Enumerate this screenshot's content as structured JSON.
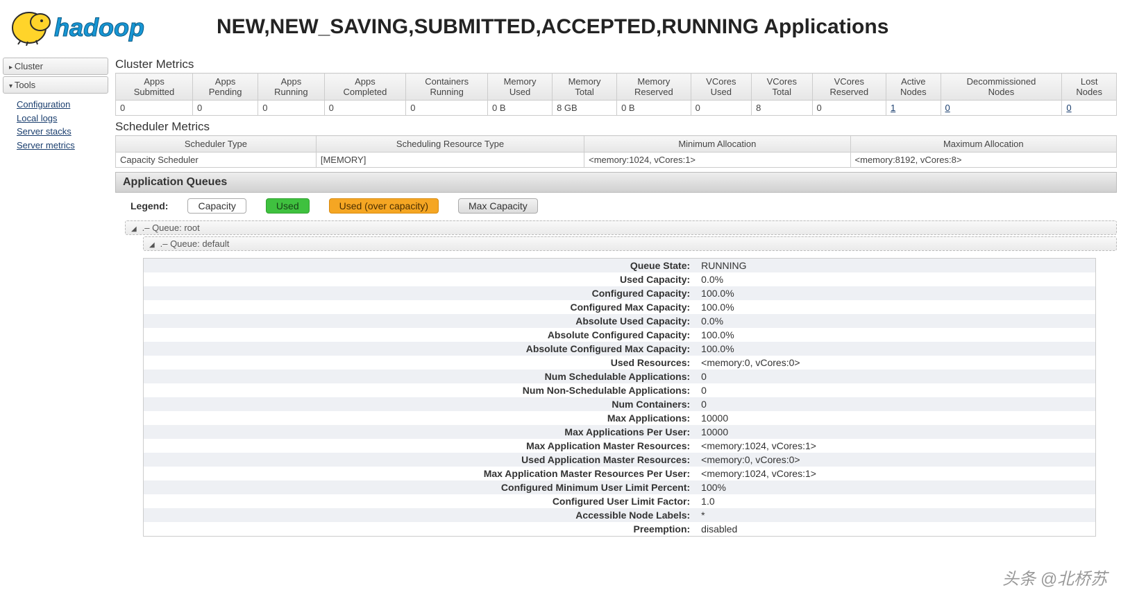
{
  "header": {
    "logo_text": "hadoop",
    "page_title": "NEW,NEW_SAVING,SUBMITTED,ACCEPTED,RUNNING Applications"
  },
  "sidebar": {
    "sections": [
      {
        "label": "Cluster",
        "expanded": false,
        "links": []
      },
      {
        "label": "Tools",
        "expanded": true,
        "links": [
          "Configuration",
          "Local logs",
          "Server stacks",
          "Server metrics"
        ]
      }
    ]
  },
  "cluster_metrics": {
    "title": "Cluster Metrics",
    "columns": [
      "Apps Submitted",
      "Apps Pending",
      "Apps Running",
      "Apps Completed",
      "Containers Running",
      "Memory Used",
      "Memory Total",
      "Memory Reserved",
      "VCores Used",
      "VCores Total",
      "VCores Reserved",
      "Active Nodes",
      "Decommissioned Nodes",
      "Lost Nodes"
    ],
    "values": [
      "0",
      "0",
      "0",
      "0",
      "0",
      "0 B",
      "8 GB",
      "0 B",
      "0",
      "8",
      "0",
      "1",
      "0",
      "0"
    ],
    "linked": [
      false,
      false,
      false,
      false,
      false,
      false,
      false,
      false,
      false,
      false,
      false,
      true,
      true,
      true
    ]
  },
  "scheduler_metrics": {
    "title": "Scheduler Metrics",
    "columns": [
      "Scheduler Type",
      "Scheduling Resource Type",
      "Minimum Allocation",
      "Maximum Allocation"
    ],
    "values": [
      "Capacity Scheduler",
      "[MEMORY]",
      "<memory:1024, vCores:1>",
      "<memory:8192, vCores:8>"
    ]
  },
  "app_queues": {
    "header": "Application Queues",
    "legend": {
      "title": "Legend:",
      "capacity": "Capacity",
      "used": "Used",
      "over": "Used (over capacity)",
      "max": "Max Capacity"
    },
    "tree": [
      {
        "label": ".– Queue: root",
        "indent": 0
      },
      {
        "label": ".– Queue: default",
        "indent": 1
      }
    ]
  },
  "queue_details": [
    {
      "k": "Queue State:",
      "v": "RUNNING"
    },
    {
      "k": "Used Capacity:",
      "v": "0.0%"
    },
    {
      "k": "Configured Capacity:",
      "v": "100.0%"
    },
    {
      "k": "Configured Max Capacity:",
      "v": "100.0%"
    },
    {
      "k": "Absolute Used Capacity:",
      "v": "0.0%"
    },
    {
      "k": "Absolute Configured Capacity:",
      "v": "100.0%"
    },
    {
      "k": "Absolute Configured Max Capacity:",
      "v": "100.0%"
    },
    {
      "k": "Used Resources:",
      "v": "<memory:0, vCores:0>"
    },
    {
      "k": "Num Schedulable Applications:",
      "v": "0"
    },
    {
      "k": "Num Non-Schedulable Applications:",
      "v": "0"
    },
    {
      "k": "Num Containers:",
      "v": "0"
    },
    {
      "k": "Max Applications:",
      "v": "10000"
    },
    {
      "k": "Max Applications Per User:",
      "v": "10000"
    },
    {
      "k": "Max Application Master Resources:",
      "v": "<memory:1024, vCores:1>"
    },
    {
      "k": "Used Application Master Resources:",
      "v": "<memory:0, vCores:0>"
    },
    {
      "k": "Max Application Master Resources Per User:",
      "v": "<memory:1024, vCores:1>"
    },
    {
      "k": "Configured Minimum User Limit Percent:",
      "v": "100%"
    },
    {
      "k": "Configured User Limit Factor:",
      "v": "1.0"
    },
    {
      "k": "Accessible Node Labels:",
      "v": "*"
    },
    {
      "k": "Preemption:",
      "v": "disabled"
    }
  ],
  "watermark": "头条 @北桥苏"
}
